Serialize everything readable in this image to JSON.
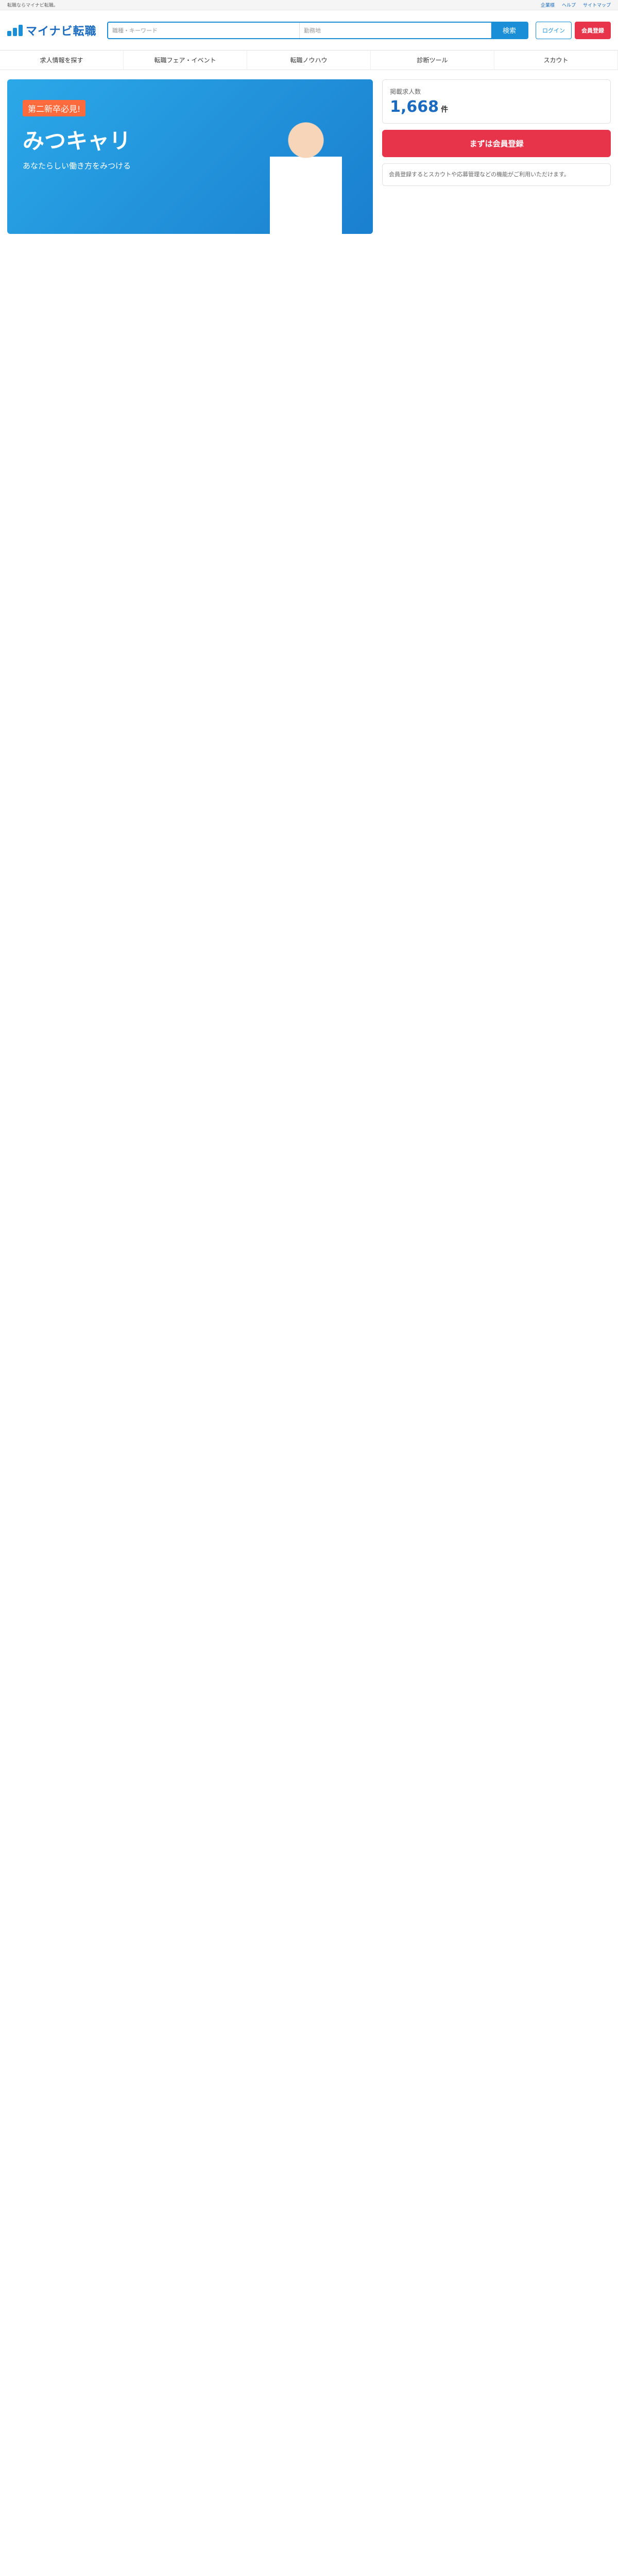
{
  "topline": {
    "left": "転職ならマイナビ転職。",
    "links": [
      "企業様",
      "ヘルプ",
      "サイトマップ"
    ]
  },
  "header": {
    "logo_text": "マイナビ転職",
    "search_keyword_placeholder": "職種・キーワード",
    "search_area_placeholder": "勤務地",
    "search_button": "検索",
    "login_label": "ログイン",
    "register_label": "会員登録"
  },
  "nav": {
    "items": [
      "求人情報を探す",
      "転職フェア・イベント",
      "転職ノウハウ",
      "診断ツール",
      "スカウト"
    ]
  },
  "hero": {
    "badge": "第二新卒必見!",
    "title": "みつキャリ",
    "subtitle": "あなたらしい働き方をみつける"
  },
  "stats": {
    "label": "掲載求人数",
    "number": "1,668",
    "unit": "件"
  },
  "side": {
    "cta": "まずは会員登録",
    "note": "会員登録するとスカウトや応募管理などの機能がご利用いただけます。"
  }
}
